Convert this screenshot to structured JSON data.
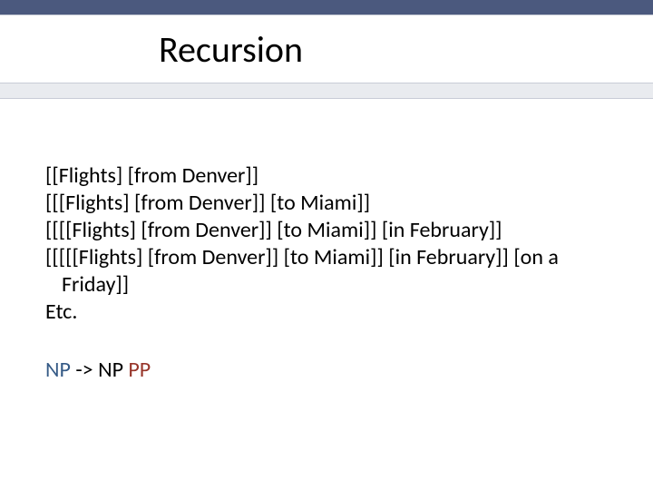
{
  "title": "Recursion",
  "examples": [
    "[[Flights] [from Denver]]",
    "[[[Flights] [from Denver]] [to Miami]]",
    "[[[[Flights] [from Denver]] [to Miami]] [in February]]",
    "[[[[[Flights] [from Denver]] [to Miami]] [in February]] [on a Friday]]",
    "Etc."
  ],
  "rule": {
    "lhs": "NP",
    "arrow": "->",
    "rhs_np": "NP",
    "rhs_pp": "PP"
  }
}
